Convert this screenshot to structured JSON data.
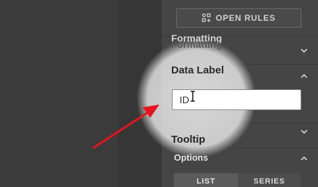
{
  "toolbar": {
    "open_rules_label": "OPEN RULES",
    "open_rules_icon": "rules-icon"
  },
  "sections": {
    "formatting": {
      "title": "Formatting",
      "expanded": false
    },
    "data_label": {
      "title": "Data Label",
      "expanded": true,
      "input_value": "ID"
    },
    "tooltip": {
      "title": "Tooltip",
      "expanded": false
    },
    "options": {
      "title": "Options",
      "expanded": true,
      "segments": [
        "LIST",
        "SERIES"
      ]
    }
  },
  "colors": {
    "annotation_arrow": "#e8141b",
    "panel_bg": "#454545"
  }
}
